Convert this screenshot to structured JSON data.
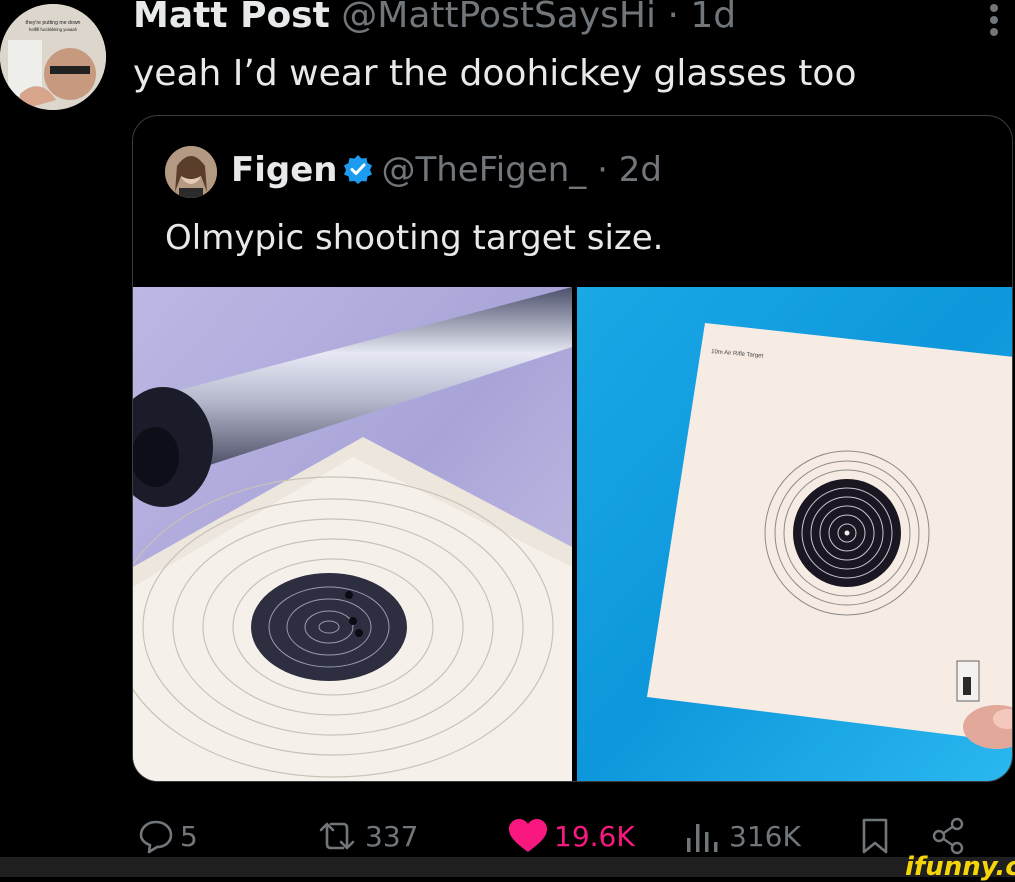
{
  "tweet": {
    "avatar_caption": "they're putting me down hellllll fucckkkking yeaaah",
    "author_name": "Matt Post",
    "author_handle": "@MattPostSaysHi",
    "separator": "·",
    "time": "1d",
    "text": "yeah I’d wear the doohickey glasses too",
    "more_icon": "more-vertical-icon"
  },
  "quote": {
    "author_name": "Figen",
    "verified": true,
    "author_handle": "@TheFigen_",
    "separator": "·",
    "time": "2d",
    "text": "Olmypic shooting target size.",
    "target_caption": "10m Air Rifle Target"
  },
  "actions": {
    "reply_count": "5",
    "retweet_count": "337",
    "like_count": "19.6K",
    "views_count": "316K"
  },
  "colors": {
    "background": "#000000",
    "text": "#e7e9ea",
    "muted": "#71767b",
    "like": "#f91880",
    "verified": "#1d9bf0",
    "watermark": "#f6d40a"
  },
  "watermark": "ifunny.co"
}
